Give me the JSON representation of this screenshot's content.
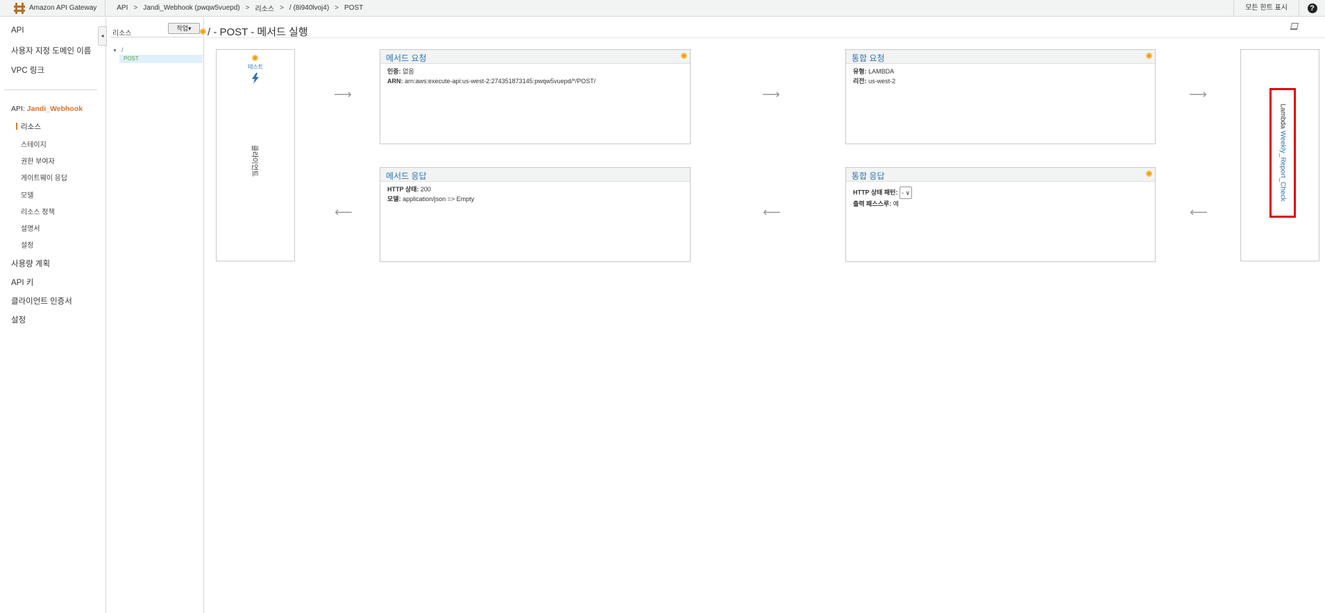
{
  "topbar": {
    "app_name": "Amazon API Gateway",
    "breadcrumbs": [
      "API",
      "Jandi_Webhook (pwqw5vuepd)",
      "리소스",
      "/ (8i940lvoj4)",
      "POST"
    ],
    "separator": ">",
    "hints_label": "모든 힌트 표시",
    "help_label": "?"
  },
  "sidebar": {
    "top_items": [
      "API",
      "사용자 지정 도메인 이름",
      "VPC 링크"
    ],
    "api_prefix": "API:",
    "api_name": "Jandi_Webhook",
    "sub_items": [
      "리소스",
      "스테이지",
      "권한 부여자",
      "게이트웨이 응답",
      "모델",
      "리소스 정책",
      "설명서",
      "설정"
    ],
    "bottom_items": [
      "사용량 계획",
      "API 키",
      "클라이언트 인증서",
      "설정"
    ],
    "collapse_glyph": "◂"
  },
  "resources": {
    "title": "리소스",
    "action_label": "작업▾",
    "root": "/",
    "tree_toggle": "▼",
    "method": "POST"
  },
  "main": {
    "title": "/ - POST - 메서드 실행",
    "client": {
      "test_label": "테스트",
      "label": "클라이언트"
    },
    "method_request": {
      "title": "메서드 요청",
      "auth_label": "인증:",
      "auth_value": "없음",
      "arn_label": "ARN:",
      "arn_value": "arn:aws:execute-api:us-west-2:274351873145:pwqw5vuepd/*/POST/"
    },
    "integration_request": {
      "title": "통합 요청",
      "type_label": "유형:",
      "type_value": "LAMBDA",
      "region_label": "리전:",
      "region_value": "us-west-2"
    },
    "method_response": {
      "title": "메서드 응답",
      "status_label": "HTTP 상태:",
      "status_value": "200",
      "model_label": "모델:",
      "model_value": "application/json => Empty"
    },
    "integration_response": {
      "title": "통합 응답",
      "pattern_label": "HTTP 상태 패턴:",
      "pattern_value": "-",
      "passthrough_label": "출력 패스스루:",
      "passthrough_value": "예"
    },
    "lambda": {
      "prefix": "Lambda",
      "function_name": "Weekly_Report_Check"
    },
    "arrows": {
      "right": "⟶",
      "left": "⟵"
    }
  },
  "colors": {
    "link": "#2d73b9",
    "accent_orange": "#d9712b",
    "highlight_red": "#e00000",
    "status_dot": "#f39c12"
  },
  "icons": [
    "amazon-api-gateway-logo-icon",
    "help-icon",
    "book-icon",
    "lightning-icon",
    "info-dot-icon"
  ]
}
